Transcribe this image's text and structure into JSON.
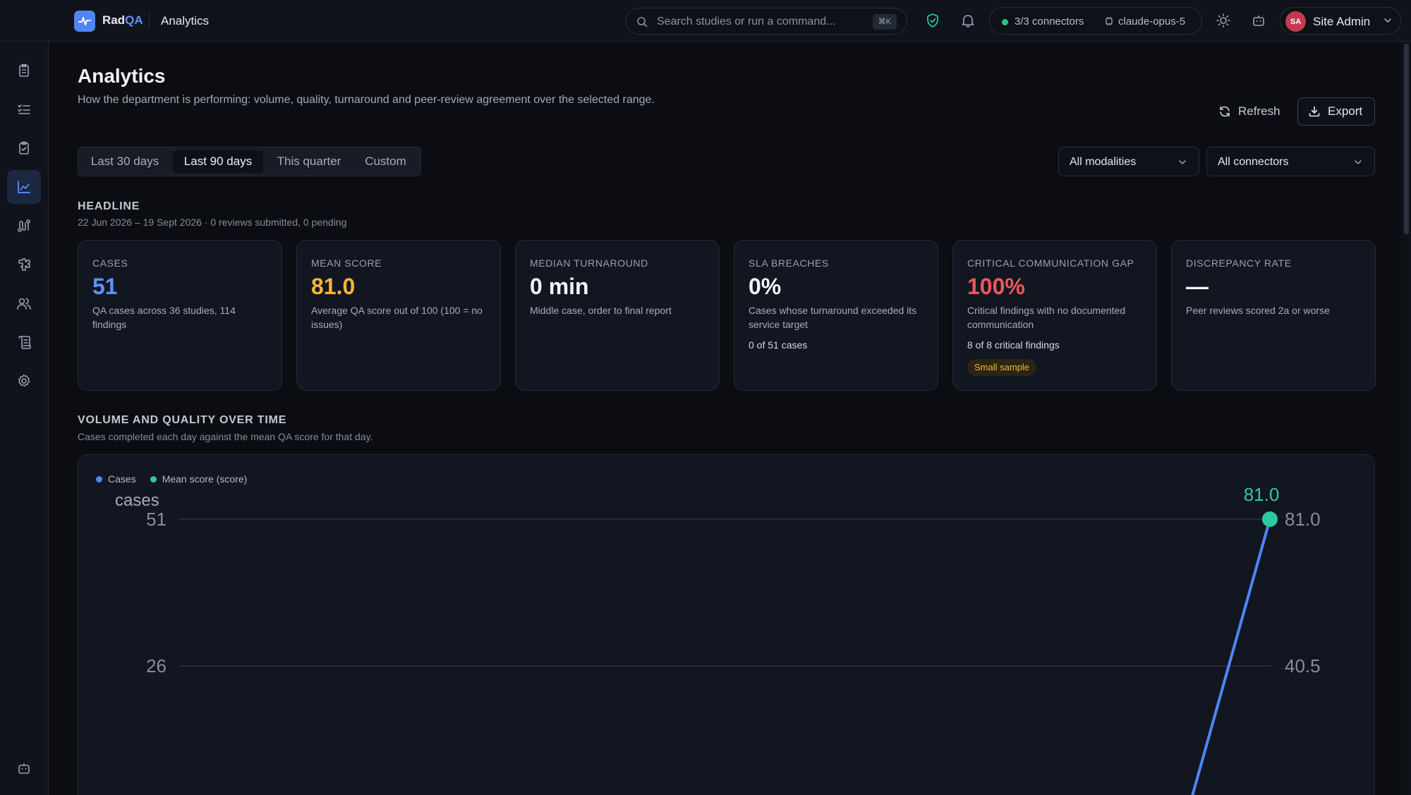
{
  "app": {
    "name_main": "Rad",
    "name_accent": "QA",
    "breadcrumb": "Analytics"
  },
  "topbar": {
    "search_placeholder": "Search studies or run a command...",
    "search_shortcut": "⌘K",
    "connectors": "3/3 connectors",
    "model": "claude-opus-5",
    "user_initials": "SA",
    "user_name": "Site Admin"
  },
  "page": {
    "title": "Analytics",
    "description": "How the department is performing: volume, quality, turnaround and peer-review agreement over the selected range.",
    "refresh_label": "Refresh",
    "export_label": "Export"
  },
  "range_tabs": [
    {
      "label": "Last 30 days",
      "active": false
    },
    {
      "label": "Last 90 days",
      "active": true
    },
    {
      "label": "This quarter",
      "active": false
    },
    {
      "label": "Custom",
      "active": false
    }
  ],
  "filters": {
    "modality": "All modalities",
    "connector": "All connectors"
  },
  "headline": {
    "title": "HEADLINE",
    "subtitle": "22 Jun 2026 – 19 Sept 2026 · 0 reviews submitted, 0 pending"
  },
  "cards": [
    {
      "label": "CASES",
      "value": "51",
      "color": "#5b93ff",
      "desc": "QA cases across 36 studies, 114 findings"
    },
    {
      "label": "MEAN SCORE",
      "value": "81.0",
      "color": "#f5b731",
      "desc": "Average QA score out of 100 (100 = no issues)"
    },
    {
      "label": "MEDIAN TURNAROUND",
      "value": "0 min",
      "color": "#f1f3f7",
      "desc": "Middle case, order to final report"
    },
    {
      "label": "SLA BREACHES",
      "value": "0%",
      "color": "#f1f3f7",
      "desc": "Cases whose turnaround exceeded its service target",
      "extra": "0 of 51 cases"
    },
    {
      "label": "CRITICAL COMMUNICATION GAP",
      "value": "100%",
      "color": "#f0565d",
      "desc": "Critical findings with no documented communication",
      "extra": "8 of 8 critical findings",
      "badge": "Small sample"
    },
    {
      "label": "DISCREPANCY RATE",
      "value": "—",
      "color": "#f1f3f7",
      "desc": "Peer reviews scored 2a or worse"
    }
  ],
  "volume_section": {
    "title": "VOLUME AND QUALITY OVER TIME",
    "subtitle": "Cases completed each day against the mean QA score for that day."
  },
  "chart_data": {
    "type": "line",
    "series": [
      {
        "name": "Cases",
        "color": "#4f86f7",
        "axis": "left",
        "values": [
          0,
          51
        ]
      },
      {
        "name": "Mean score (score)",
        "color": "#2ec9a0",
        "axis": "right",
        "values": [
          null,
          81.0
        ]
      }
    ],
    "y_left": {
      "label": "cases",
      "ticks": [
        "51",
        "26"
      ],
      "range": [
        0,
        51
      ]
    },
    "y_right": {
      "ticks": [
        "81.0",
        "40.5"
      ],
      "range": [
        0,
        81
      ]
    },
    "point_label": "81.0",
    "grid": true,
    "legend": "top-left"
  },
  "colors": {
    "accent": "#4f86f7",
    "success": "#2ec27e",
    "danger": "#f0565d",
    "warning": "#f5b731"
  }
}
